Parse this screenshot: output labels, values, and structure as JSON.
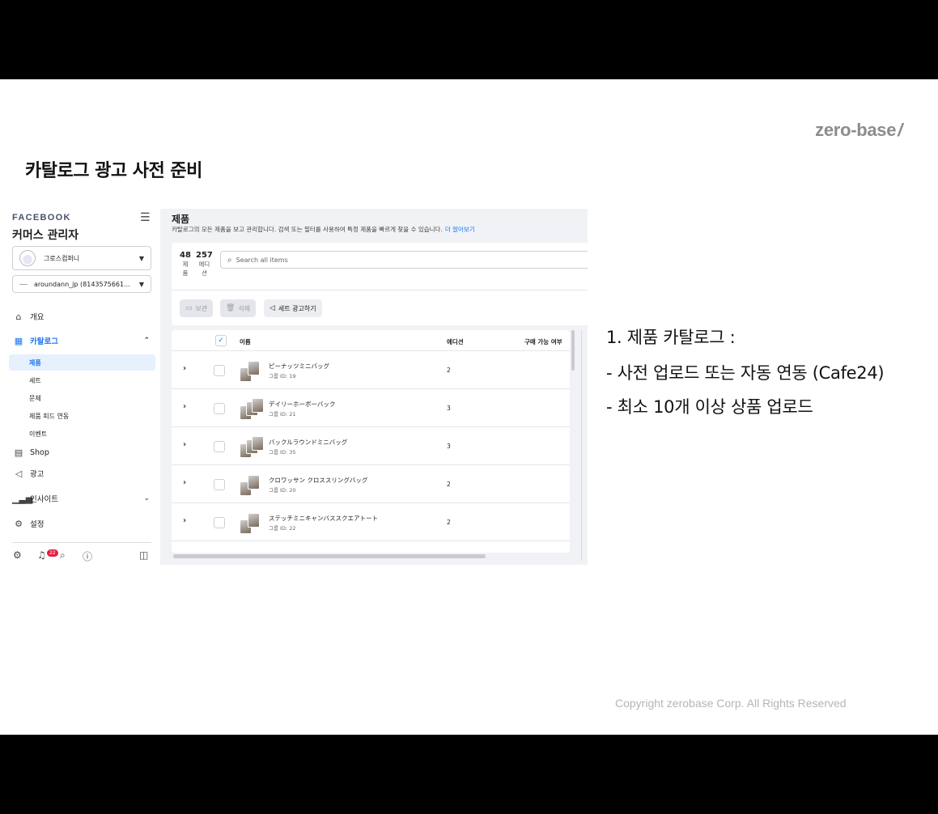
{
  "brand": {
    "name": "zero-base",
    "slash": "/"
  },
  "slide_title": "카탈로그 광고 사전 준비",
  "sidebar": {
    "logo": "FACEBOOK",
    "menu_icon": "hamburger-icon",
    "title": "커머스 관리자",
    "business_select": "그로스컴퍼니",
    "catalog_select": "aroundann_jp (8143575661...",
    "nav": [
      {
        "label": "개요",
        "icon": "home-icon"
      },
      {
        "label": "카탈로그",
        "icon": "grid-icon",
        "active": true
      },
      {
        "label": "Shop",
        "icon": "shop-icon"
      },
      {
        "label": "광고",
        "icon": "megaphone-icon"
      },
      {
        "label": "인사이트",
        "icon": "chart-icon"
      },
      {
        "label": "설정",
        "icon": "gear-icon"
      }
    ],
    "catalog_sub": [
      "제품",
      "세트",
      "문제",
      "제품 피드 연동",
      "이벤트"
    ],
    "notification_count": "22"
  },
  "main": {
    "title": "제품",
    "description": "카탈로그의 모든 제품을 보고 관리합니다. 검색 또는 필터를 사용하여 특정 제품을 빠르게 찾을 수 있습니다.",
    "learn_more": "더 알아보기",
    "stats": [
      {
        "value": "48",
        "label_line1": "제",
        "label_line2": "품"
      },
      {
        "value": "257",
        "label_line1": "에디",
        "label_line2": "션"
      }
    ],
    "search_placeholder": "Search all items",
    "toolbar": {
      "archive": "보관",
      "delete": "삭제",
      "set_ad": "세트 광고하기"
    },
    "table": {
      "columns": [
        "이름",
        "에디션",
        "구매 가능 여부"
      ],
      "rows": [
        {
          "name": "ピーナッツミニバッグ",
          "group_id": "그룹 ID: 19",
          "editions": "2"
        },
        {
          "name": "デイリーホーボーバック",
          "group_id": "그룹 ID: 21",
          "editions": "3"
        },
        {
          "name": "バックルラウンドミニバッグ",
          "group_id": "그룹 ID: 35",
          "editions": "3"
        },
        {
          "name": "クロワッサン クロススリングバッグ",
          "group_id": "그룹 ID: 20",
          "editions": "2"
        },
        {
          "name": "ステッチミニキャンバススクエアトート",
          "group_id": "그룹 ID: 22",
          "editions": "2"
        }
      ]
    }
  },
  "points": {
    "heading": "1.   제품 카탈로그 :",
    "item1": "-    사전 업로드 또는 자동 연동 (Cafe24)",
    "item2": "-    최소 10개 이상 상품 업로드"
  },
  "copyright": "Copyright zerobase Corp. All Rights Reserved"
}
